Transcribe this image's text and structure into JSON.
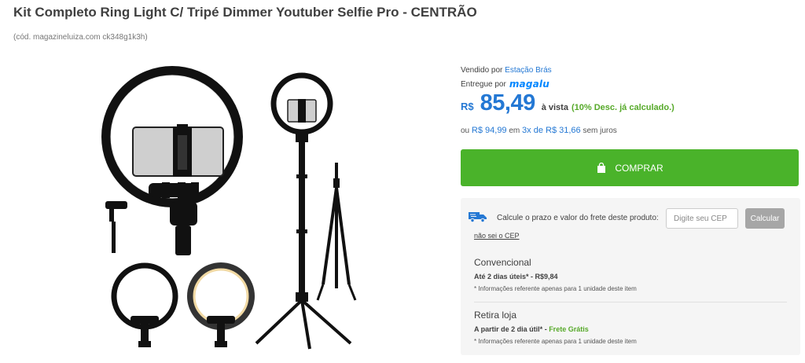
{
  "product": {
    "title": "Kit Completo Ring Light C/ Tripé Dimmer Youtuber Selfie Pro - CENTRÃO",
    "code": "(cód. magazineluiza.com ck348g1k3h)"
  },
  "seller": {
    "sold_by_label": "Vendido por",
    "sold_by_name": "Estação Brás",
    "delivered_by_label": "Entregue por",
    "delivered_by_logo": "magalu"
  },
  "price": {
    "currency": "R$",
    "value": "85,49",
    "cash_label": "à vista",
    "discount_label": "(10% Desc. já calculado.)",
    "installments_prefix": "ou",
    "full_price": "R$ 94,99",
    "installments_mid": "em",
    "installments": "3x de R$ 31,66",
    "installments_suffix": "sem juros"
  },
  "buy_button": {
    "label": "COMPRAR",
    "icon": "shopping-bag-icon"
  },
  "shipping": {
    "label": "Calcule o prazo e valor do frete deste produto:",
    "cep_placeholder": "Digite seu CEP",
    "calc_label": "Calcular",
    "no_cep_link": "não sei o CEP",
    "icon": "truck-icon",
    "options": [
      {
        "name": "Convencional",
        "time": "Até 2 dias úteis*",
        "sep": " - ",
        "cost": "R$9,84",
        "note": "* Informações referente apenas para 1 unidade deste item"
      },
      {
        "name": "Retira loja",
        "time": "A partir de 2 dia útil*",
        "sep": " - ",
        "cost": "Frete Grátis",
        "note": "* Informações referente apenas para 1 unidade deste item"
      }
    ]
  },
  "colors": {
    "price_blue": "#2478d4",
    "buy_green": "#4ab32a",
    "free_green": "#56a929",
    "magalu_blue": "#0086ff"
  }
}
